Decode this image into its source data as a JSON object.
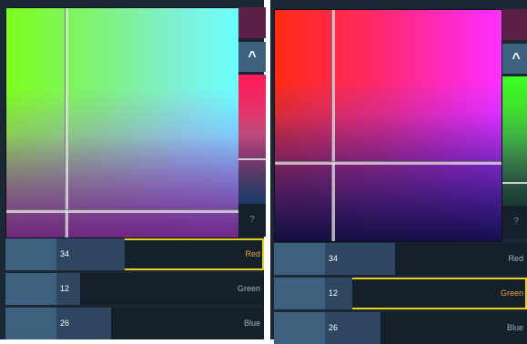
{
  "panels": [
    {
      "id": "left",
      "side_buttons": {
        "up_label": "^",
        "help_label": "?"
      },
      "sliders": [
        {
          "label": "Red",
          "value": "34",
          "fraction": 0.46,
          "active": true
        },
        {
          "label": "Green",
          "value": "12",
          "fraction": 0.29,
          "active": false
        },
        {
          "label": "Blue",
          "value": "26",
          "fraction": 0.41,
          "active": false
        }
      ]
    },
    {
      "id": "right",
      "side_buttons": {
        "up_label": "^",
        "help_label": "?"
      },
      "sliders": [
        {
          "label": "Red",
          "value": "34",
          "fraction": 0.48,
          "active": false
        },
        {
          "label": "Green",
          "value": "12",
          "fraction": 0.31,
          "active": true
        },
        {
          "label": "Blue",
          "value": "26",
          "fraction": 0.42,
          "active": false
        }
      ]
    }
  ],
  "colors": {
    "highlight": "#e5d21a",
    "active_label": "#e8a43a",
    "panel_bg": "#1b2734"
  }
}
